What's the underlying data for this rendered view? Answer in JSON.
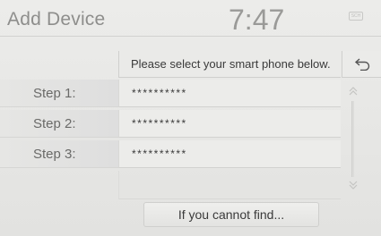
{
  "header": {
    "title": "Add Device",
    "clock": "7:47",
    "status_icon_label": "SCH"
  },
  "prompt": "Please select your smart phone below.",
  "back_icon": "return-arrow-icon",
  "steps": [
    {
      "label": "Step 1:",
      "value": "**********"
    },
    {
      "label": "Step 2:",
      "value": "**********"
    },
    {
      "label": "Step 3:",
      "value": "**********"
    }
  ],
  "scroll": {
    "up_icon": "chevron-double-up-icon",
    "down_icon": "chevron-double-down-icon"
  },
  "cannot_find_button": "If you cannot find..."
}
